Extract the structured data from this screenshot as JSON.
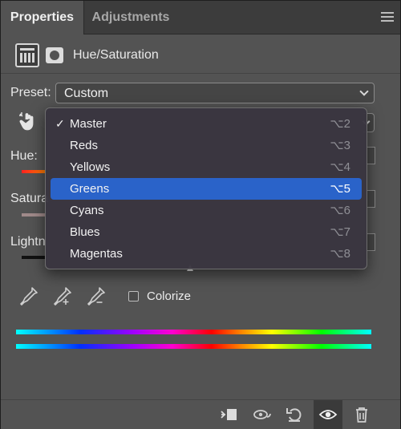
{
  "tabs": [
    {
      "label": "Properties",
      "active": true
    },
    {
      "label": "Adjustments",
      "active": false
    }
  ],
  "header": {
    "title": "Hue/Saturation",
    "adjustment_icon": "adjustment-layer-icon",
    "mask_icon": "layer-mask-icon"
  },
  "preset": {
    "label": "Preset:",
    "value": "Custom"
  },
  "sliders": {
    "hue_label": "Hue:",
    "saturation_label": "Satura",
    "lightness_label": "Lightn"
  },
  "channel_menu": {
    "items": [
      {
        "label": "Master",
        "shortcut": "⌥2",
        "checked": true,
        "highlighted": false
      },
      {
        "label": "Reds",
        "shortcut": "⌥3",
        "checked": false,
        "highlighted": false
      },
      {
        "label": "Yellows",
        "shortcut": "⌥4",
        "checked": false,
        "highlighted": false
      },
      {
        "label": "Greens",
        "shortcut": "⌥5",
        "checked": false,
        "highlighted": true
      },
      {
        "label": "Cyans",
        "shortcut": "⌥6",
        "checked": false,
        "highlighted": false
      },
      {
        "label": "Blues",
        "shortcut": "⌥7",
        "checked": false,
        "highlighted": false
      },
      {
        "label": "Magentas",
        "shortcut": "⌥8",
        "checked": false,
        "highlighted": false
      }
    ],
    "check_mark": "✓"
  },
  "colorize": {
    "label": "Colorize",
    "checked": false
  },
  "colors": {
    "panel_bg": "#535353",
    "tab_bar_bg": "#3c3c3c",
    "menu_highlight": "#2a63c9",
    "menu_bg": "#3a3640"
  }
}
